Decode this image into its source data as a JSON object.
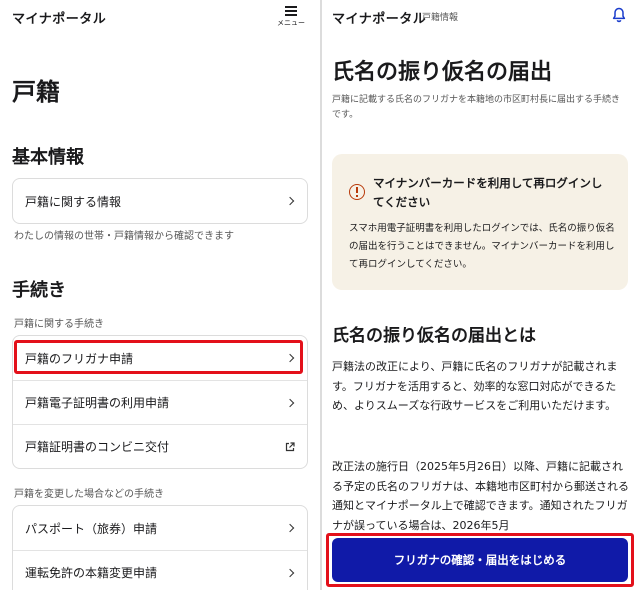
{
  "left": {
    "brand": "マイナポータル",
    "menu_label": "メニュー",
    "page_title": "戸籍",
    "section_basic": {
      "title": "基本情報",
      "items": [
        {
          "label": "戸籍に関する情報"
        }
      ],
      "note": "わたしの情報の世帯・戸籍情報から確認できます"
    },
    "section_procedures": {
      "title": "手続き",
      "group1_label": "戸籍に関する手続き",
      "group1_items": [
        {
          "label": "戸籍のフリガナ申請",
          "icon": "chevron-right-icon"
        },
        {
          "label": "戸籍電子証明書の利用申請",
          "icon": "chevron-right-icon"
        },
        {
          "label": "戸籍証明書のコンビニ交付",
          "icon": "external-link-icon"
        }
      ],
      "group2_label": "戸籍を変更した場合などの手続き",
      "group2_items": [
        {
          "label": "パスポート（旅券）申請",
          "icon": "chevron-right-icon"
        },
        {
          "label": "運転免許の本籍変更申請",
          "icon": "chevron-right-icon"
        }
      ]
    }
  },
  "right": {
    "brand": "マイナポータル",
    "brand_sub": "戸籍情報",
    "title": "氏名の振り仮名の届出",
    "description": "戸籍に記載する氏名のフリガナを本籍地の市区町村長に届出する手続きです。",
    "notice": {
      "heading": "マイナンバーカードを利用して再ログインしてください",
      "body": "スマホ用電子証明書を利用したログインでは、氏名の振り仮名の届出を行うことはできません。マイナンバーカードを利用して再ログインしてください。"
    },
    "section_title": "氏名の振り仮名の届出とは",
    "paragraph1": "戸籍法の改正により、戸籍に氏名のフリガナが記載されます。フリガナを活用すると、効率的な窓口対応ができるため、よりスムーズな行政サービスをご利用いただけます。",
    "paragraph2": "改正法の施行日（2025年5月26日）以降、戸籍に記載される予定の氏名のフリガナは、本籍地市区町村から郵送される通知とマイナポータル上で確認できます。通知されたフリガナが誤っている場合は、2026年5月",
    "cta_label": "フリガナの確認・届出をはじめる"
  },
  "colors": {
    "accent": "#101aa8",
    "highlight": "#e3101a",
    "notice_bg": "#f6f1e6",
    "warning_icon": "#b83a0a",
    "bell_icon": "#1a3ccc"
  }
}
